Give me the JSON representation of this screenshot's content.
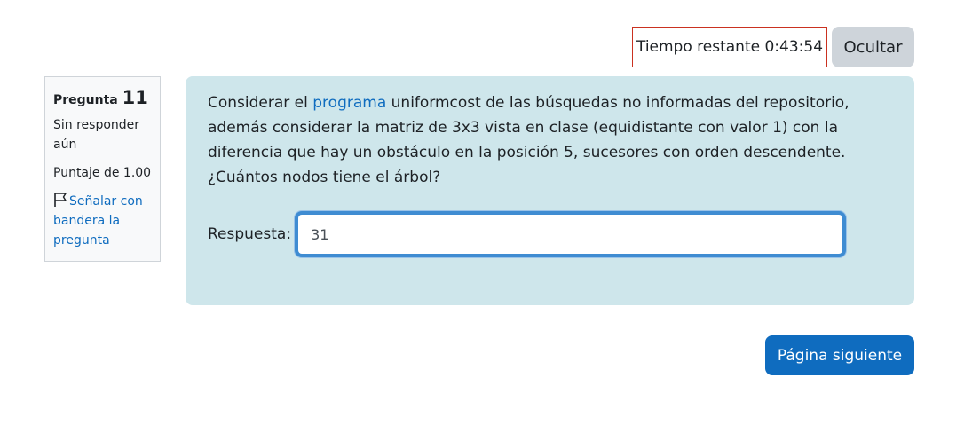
{
  "timer": {
    "label": "Tiempo restante",
    "value": "0:43:54",
    "hide_label": "Ocultar"
  },
  "info": {
    "question_word": "Pregunta",
    "question_number": "11",
    "state": "Sin responder aún",
    "grade": "Puntaje de 1.00",
    "flag_label": "Señalar con bandera la pregunta"
  },
  "question": {
    "text_before_link": "Considerar el ",
    "link_text": "programa",
    "text_after_link": " uniformcost de las búsquedas no informadas del repositorio, además considerar la matriz de 3x3 vista en clase (equidistante con valor 1) con la diferencia que hay un obstáculo en la posición 5, sucesores con orden descendente. ¿Cuántos nodos tiene el árbol?",
    "answer_label": "Respuesta:",
    "answer_value": "31"
  },
  "navigation": {
    "next_label": "Página siguiente"
  },
  "colors": {
    "accent": "#0f6cbf",
    "content_bg": "#cee6eb",
    "timer_border": "#ca3120",
    "hide_button_bg": "#ced4da"
  },
  "icons": {
    "flag": "flag-icon"
  }
}
